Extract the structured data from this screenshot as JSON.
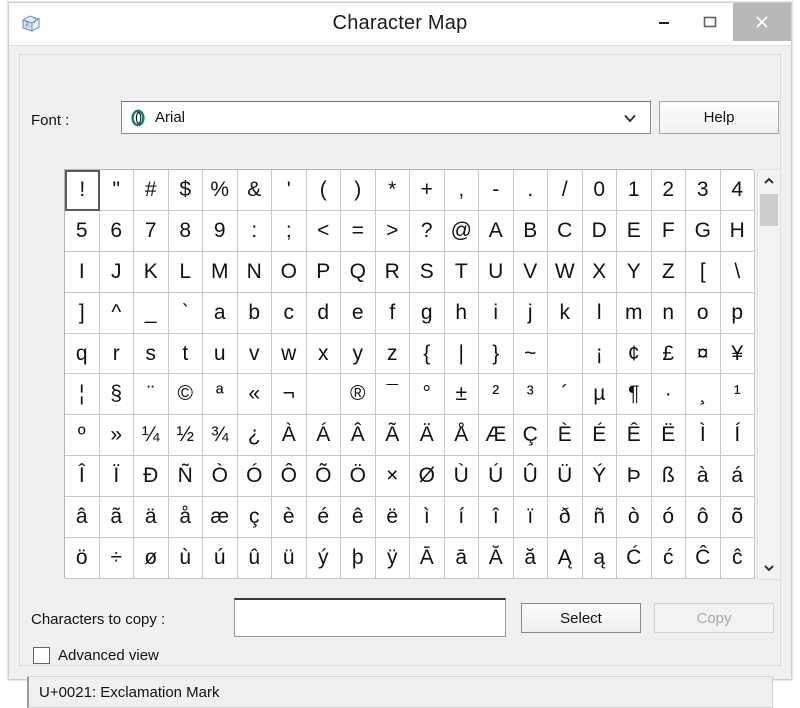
{
  "window": {
    "title": "Character Map",
    "app_icon": "character-map-icon",
    "controls": {
      "minimize": "minimize-icon",
      "maximize": "maximize-icon",
      "close": "close-icon"
    }
  },
  "font_row": {
    "label": "Font :",
    "selected_font": "Arial",
    "font_type_icon": "opentype-icon",
    "dropdown_icon": "chevron-down-icon",
    "help_label": "Help"
  },
  "grid": {
    "selected_index": 0,
    "columns": 20,
    "rows": 10,
    "characters": [
      "!",
      "\"",
      "#",
      "$",
      "%",
      "&",
      "'",
      "(",
      ")",
      "*",
      "+",
      ",",
      "-",
      ".",
      "/",
      "0",
      "1",
      "2",
      "3",
      "4",
      "5",
      "6",
      "7",
      "8",
      "9",
      ":",
      ";",
      "<",
      "=",
      ">",
      "?",
      "@",
      "A",
      "B",
      "C",
      "D",
      "E",
      "F",
      "G",
      "H",
      "I",
      "J",
      "K",
      "L",
      "M",
      "N",
      "O",
      "P",
      "Q",
      "R",
      "S",
      "T",
      "U",
      "V",
      "W",
      "X",
      "Y",
      "Z",
      "[",
      "\\",
      "]",
      "^",
      "_",
      "`",
      "a",
      "b",
      "c",
      "d",
      "e",
      "f",
      "g",
      "h",
      "i",
      "j",
      "k",
      "l",
      "m",
      "n",
      "o",
      "p",
      "q",
      "r",
      "s",
      "t",
      "u",
      "v",
      "w",
      "x",
      "y",
      "z",
      "{",
      "|",
      "}",
      "~",
      " ",
      "¡",
      "¢",
      "£",
      "¤",
      "¥",
      "¦",
      "§",
      "¨",
      "©",
      "ª",
      "«",
      "¬",
      "­",
      "®",
      "¯",
      "°",
      "±",
      "²",
      "³",
      "´",
      "µ",
      "¶",
      "·",
      "¸",
      "¹",
      "º",
      "»",
      "¼",
      "½",
      "¾",
      "¿",
      "À",
      "Á",
      "Â",
      "Ã",
      "Ä",
      "Å",
      "Æ",
      "Ç",
      "È",
      "É",
      "Ê",
      "Ë",
      "Ì",
      "Í",
      "Î",
      "Ï",
      "Ð",
      "Ñ",
      "Ò",
      "Ó",
      "Ô",
      "Õ",
      "Ö",
      "×",
      "Ø",
      "Ù",
      "Ú",
      "Û",
      "Ü",
      "Ý",
      "Þ",
      "ß",
      "à",
      "á",
      "â",
      "ã",
      "ä",
      "å",
      "æ",
      "ç",
      "è",
      "é",
      "ê",
      "ë",
      "ì",
      "í",
      "î",
      "ï",
      "ð",
      "ñ",
      "ò",
      "ó",
      "ô",
      "õ",
      "ö",
      "÷",
      "ø",
      "ù",
      "ú",
      "û",
      "ü",
      "ý",
      "þ",
      "ÿ",
      "Ā",
      "ā",
      "Ă",
      "ă",
      "Ą",
      "ą",
      "Ć",
      "ć",
      "Ĉ",
      "ĉ"
    ]
  },
  "scrollbar": {
    "up_icon": "chevron-up-icon",
    "down_icon": "chevron-down-icon",
    "thumb": "scrollbar-thumb"
  },
  "bottom": {
    "copy_label": "Characters to copy :",
    "copy_value": "",
    "copy_placeholder": "",
    "select_label": "Select",
    "copy_button_label": "Copy",
    "copy_button_enabled": false,
    "advanced_view_label": "Advanced view",
    "advanced_view_checked": false
  },
  "status": {
    "text": "U+0021: Exclamation Mark"
  },
  "colors": {
    "window_bg": "#f0f0f0",
    "titlebar_bg": "#ffffff",
    "close_hover_bg": "#b8b8b8",
    "grid_bg": "#ffffff",
    "grid_line": "#c8c8c8",
    "selection_border": "#5a5a5a",
    "opentype_icon": "#0f7d72",
    "disabled_text": "#a8a8a8"
  }
}
